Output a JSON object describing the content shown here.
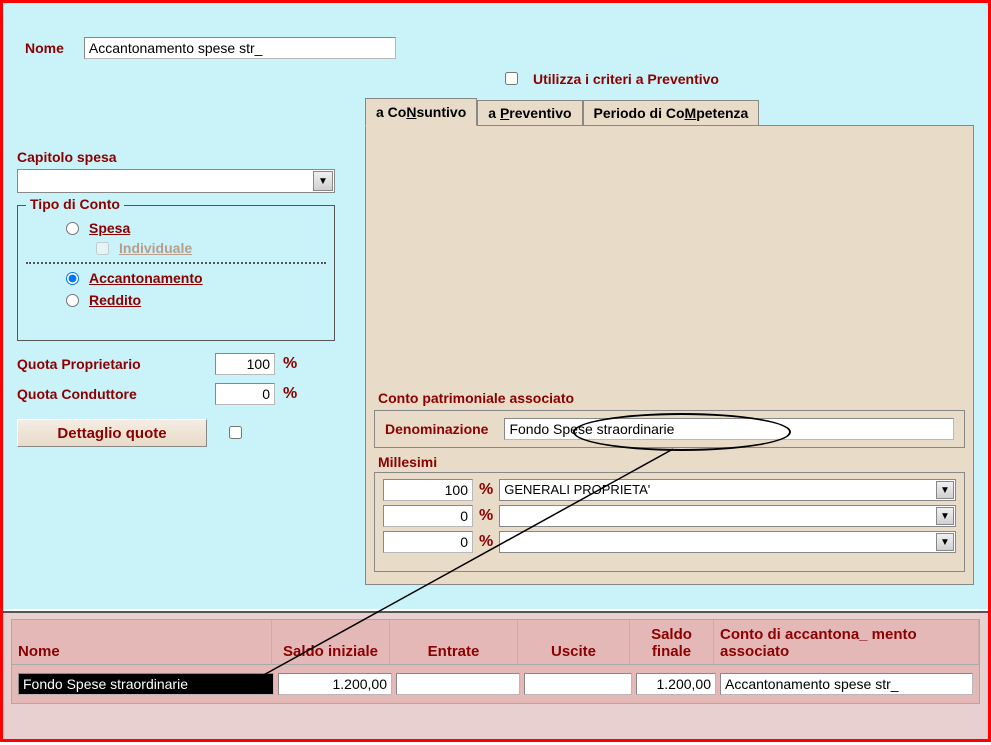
{
  "nome_label": "Nome",
  "nome_value": "Accantonamento spese str_",
  "capitolo_label": "Capitolo spesa",
  "tipo_conto": {
    "legend": "Tipo di Conto",
    "spesa": "Spesa",
    "individuale": "Individuale",
    "accantonamento": "Accantonamento",
    "reddito": "Reddito"
  },
  "quota_prop_label": "Quota Proprietario",
  "quota_prop_value": "100",
  "quota_cond_label": "Quota Conduttore",
  "quota_cond_value": "0",
  "dettaglio_btn": "Dettaglio quote",
  "criteri_label": "Utilizza i criteri a Preventivo",
  "tabs": {
    "consuntivo": "a CoNsuntivo",
    "preventivo": "a Preventivo",
    "competenza": "Periodo di CoMpetenza"
  },
  "conto_patr_label": "Conto patrimoniale associato",
  "denominazione_label": "Denominazione",
  "denominazione_value": "Fondo Spese straordinarie",
  "millesimi_label": "Millesimi",
  "millesimi": [
    {
      "pct": "100",
      "val": "GENERALI PROPRIETA'"
    },
    {
      "pct": "0",
      "val": ""
    },
    {
      "pct": "0",
      "val": ""
    }
  ],
  "table": {
    "headers": {
      "nome": "Nome",
      "saldo_iniziale": "Saldo iniziale",
      "entrate": "Entrate",
      "uscite": "Uscite",
      "saldo_finale": "Saldo finale",
      "conto_assoc": "Conto di accantona_ mento associato"
    },
    "row": {
      "nome": "Fondo Spese straordinarie",
      "saldo_iniziale": "1.200,00",
      "entrate": "",
      "uscite": "",
      "saldo_finale": "1.200,00",
      "conto_assoc": "Accantonamento spese str_"
    }
  }
}
